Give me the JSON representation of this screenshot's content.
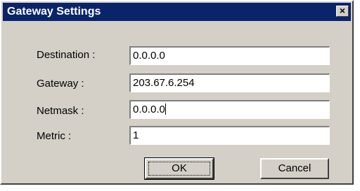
{
  "window": {
    "title": "Gateway Settings",
    "close_glyph": "×"
  },
  "fields": {
    "destination": {
      "label": "Destination :",
      "value": "0.0.0.0"
    },
    "gateway": {
      "label": "Gateway :",
      "value": "203.67.6.254"
    },
    "netmask": {
      "label": "Netmask :",
      "value": "0.0.0.0"
    },
    "metric": {
      "label": "Metric :",
      "value": "1"
    }
  },
  "buttons": {
    "ok_label": "OK",
    "cancel_label": "Cancel"
  }
}
